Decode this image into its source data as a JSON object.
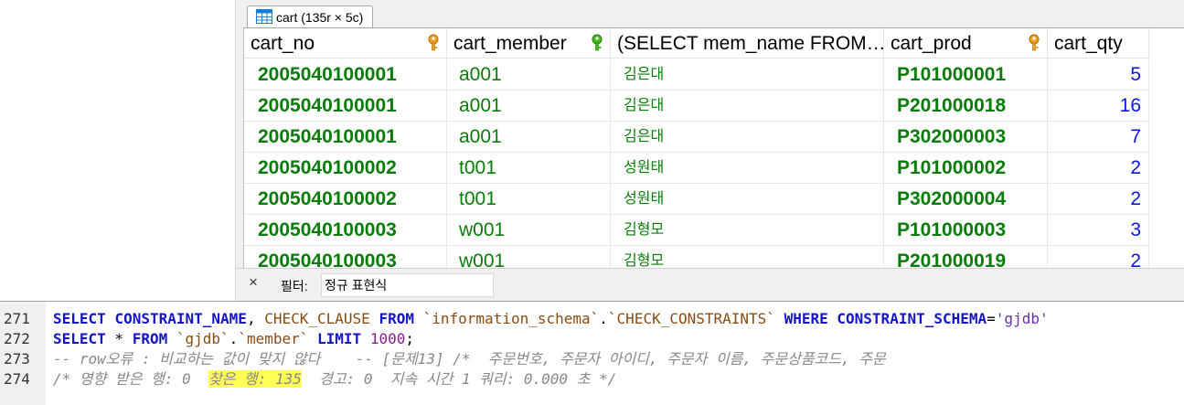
{
  "tab": {
    "label": "cart (135r × 5c)"
  },
  "grid": {
    "columns": [
      {
        "label": "cart_no",
        "key": "orange"
      },
      {
        "label": "cart_member",
        "key": "green"
      },
      {
        "label": "(SELECT mem_name FROM…",
        "key": ""
      },
      {
        "label": "cart_prod",
        "key": "orange"
      },
      {
        "label": "cart_qty",
        "key": ""
      }
    ],
    "rows": [
      [
        "2005040100001",
        "a001",
        "김은대",
        "P101000001",
        "5"
      ],
      [
        "2005040100001",
        "a001",
        "김은대",
        "P201000018",
        "16"
      ],
      [
        "2005040100001",
        "a001",
        "김은대",
        "P302000003",
        "7"
      ],
      [
        "2005040100002",
        "t001",
        "성원태",
        "P101000002",
        "2"
      ],
      [
        "2005040100002",
        "t001",
        "성원태",
        "P302000004",
        "2"
      ],
      [
        "2005040100003",
        "w001",
        "김형모",
        "P101000003",
        "3"
      ],
      [
        "2005040100003",
        "w001",
        "김형모",
        "P201000019",
        "2"
      ]
    ]
  },
  "filter": {
    "close": "×",
    "label": "필터:",
    "placeholder": "정규 표현식"
  },
  "editor": {
    "lines": [
      {
        "no": "271",
        "parts": [
          [
            "kw",
            "SELECT"
          ],
          [
            "plain",
            " "
          ],
          [
            "kw",
            "CONSTRAINT_NAME"
          ],
          [
            "plain",
            ", "
          ],
          [
            "id",
            "CHECK_CLAUSE"
          ],
          [
            "plain",
            " "
          ],
          [
            "kw",
            "FROM"
          ],
          [
            "plain",
            " "
          ],
          [
            "id",
            "`information_schema`"
          ],
          [
            "plain",
            "."
          ],
          [
            "id",
            "`CHECK_CONSTRAINTS`"
          ],
          [
            "plain",
            " "
          ],
          [
            "kw",
            "WHERE"
          ],
          [
            "plain",
            " "
          ],
          [
            "kw",
            "CONSTRAINT_SCHEMA"
          ],
          [
            "plain",
            "="
          ],
          [
            "str",
            "'gjdb'"
          ]
        ]
      },
      {
        "no": "272",
        "parts": [
          [
            "kw",
            "SELECT"
          ],
          [
            "plain",
            " * "
          ],
          [
            "kw",
            "FROM"
          ],
          [
            "plain",
            " "
          ],
          [
            "id",
            "`gjdb`"
          ],
          [
            "plain",
            "."
          ],
          [
            "id",
            "`member`"
          ],
          [
            "plain",
            " "
          ],
          [
            "kw",
            "LIMIT"
          ],
          [
            "plain",
            " "
          ],
          [
            "num",
            "1000"
          ],
          [
            "plain",
            ";"
          ]
        ]
      },
      {
        "no": "273",
        "parts": [
          [
            "cmt",
            "-- row오류 : 비교하는 값이 맞지 않다    -- [문제13] /*  주문번호, 주문자 아이디, 주문자 이름, 주문상품코드, 주문"
          ]
        ]
      },
      {
        "no": "274",
        "parts": [
          [
            "cmt",
            "/* 영향 받은 행: 0  "
          ],
          [
            "cmt hl",
            "찾은 행: 135"
          ],
          [
            "cmt",
            "  경고: 0  지속 시간 1 쿼리: 0.000 초 */"
          ]
        ]
      }
    ]
  }
}
